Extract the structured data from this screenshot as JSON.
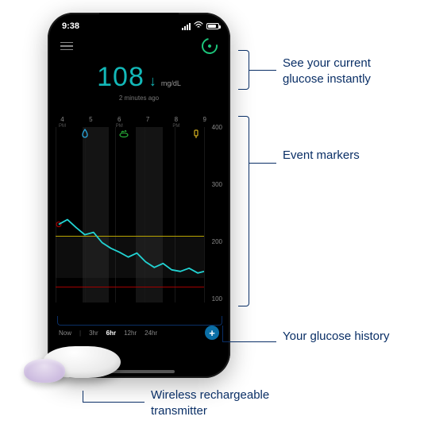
{
  "statusbar": {
    "time": "9:38"
  },
  "header": {
    "menu_name": "menu",
    "sensor_name": "sensor-status"
  },
  "reading": {
    "value": "108",
    "trend": "↓",
    "unit": "mg/dL",
    "timestamp": "2 minutes ago"
  },
  "chart_data": {
    "type": "line",
    "title": "",
    "xlabel": "",
    "ylabel": "",
    "ylim": [
      50,
      400
    ],
    "x_hours": [
      "4",
      "5",
      "6",
      "7",
      "8",
      "9"
    ],
    "x_ampm": "PM",
    "y_ticks": [
      400,
      300,
      200,
      100
    ],
    "target_band": [
      70,
      180
    ],
    "series": [
      {
        "name": "Glucose",
        "color": "#22d3d3",
        "x": [
          4.0,
          4.3,
          4.6,
          4.9,
          5.2,
          5.5,
          5.8,
          6.1,
          6.4,
          6.7,
          7.0,
          7.3,
          7.6,
          7.9,
          8.2,
          8.5,
          8.8,
          9.1
        ],
        "values": [
          205,
          215,
          200,
          185,
          190,
          170,
          158,
          150,
          140,
          148,
          130,
          120,
          128,
          115,
          112,
          118,
          108,
          112
        ]
      }
    ],
    "event_markers": [
      {
        "type": "calibration",
        "x": 5.0,
        "color": "#2aa9e0"
      },
      {
        "type": "meal",
        "x": 6.3,
        "color": "#2ecc40"
      },
      {
        "type": "insulin",
        "x": 8.8,
        "color": "#d4b020"
      }
    ]
  },
  "range_selector": {
    "now_label": "Now",
    "options": [
      "3hr",
      "6hr",
      "12hr",
      "24hr"
    ],
    "active": "6hr",
    "add_label": "+"
  },
  "callouts": {
    "current": "See your current glucose instantly",
    "markers": "Event markers",
    "history": "Your glucose history",
    "transmitter": "Wireless  rechargeable transmitter"
  }
}
